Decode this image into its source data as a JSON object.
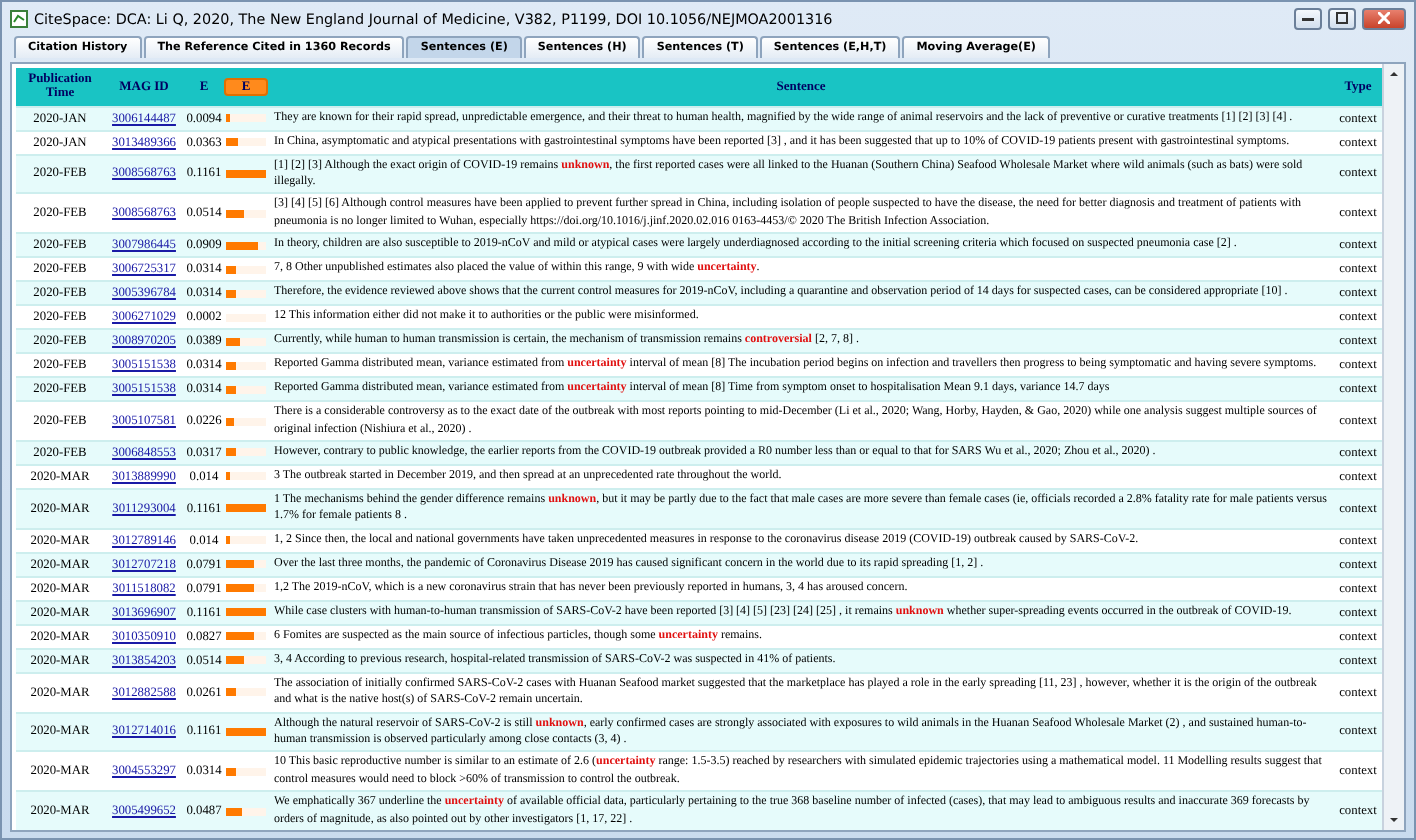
{
  "window": {
    "title": "CiteSpace: DCA: Li Q, 2020, The New England Journal of Medicine, V382, P1199, DOI 10.1056/NEJMOA2001316"
  },
  "tabs": [
    {
      "label": "Citation History",
      "selected": false
    },
    {
      "label": "The Reference Cited in 1360 Records",
      "selected": false
    },
    {
      "label": "Sentences (E)",
      "selected": true
    },
    {
      "label": "Sentences (H)",
      "selected": false
    },
    {
      "label": "Sentences (T)",
      "selected": false
    },
    {
      "label": "Sentences (E,H,T)",
      "selected": false
    },
    {
      "label": "Moving Average(E)",
      "selected": false
    }
  ],
  "table": {
    "columns": [
      {
        "label": "Publication Time",
        "kind": "text"
      },
      {
        "label": "MAG ID",
        "kind": "text"
      },
      {
        "label": "E",
        "kind": "text"
      },
      {
        "label": "E",
        "kind": "button"
      },
      {
        "label": "Sentence",
        "kind": "text"
      },
      {
        "label": "Type",
        "kind": "text"
      }
    ],
    "rows": [
      {
        "time": "2020-JAN",
        "mag_id": "3006144487",
        "e": "0.0094",
        "level": 0.081,
        "sentence": "They are known for their rapid spread, unpredictable emergence, and their threat to human health, magnified by the wide range of animal reservoirs and the lack of preventive or curative treatments [1] [2] [3] [4] .",
        "type": "context"
      },
      {
        "time": "2020-JAN",
        "mag_id": "3013489366",
        "e": "0.0363",
        "level": 0.313,
        "sentence": "In China, asymptomatic and atypical presentations with gastrointestinal symptoms have been reported [3] , and it has been suggested that up to 10% of COVID-19 patients present with gastrointestinal symptoms.",
        "type": "context"
      },
      {
        "time": "2020-FEB",
        "mag_id": "3008568763",
        "e": "0.1161",
        "level": 1,
        "sentence": "[1] [2] [3] Although the exact origin of COVID-19 remains **unknown**, the first reported cases were all linked to the Huanan (Southern China) Seafood Wholesale Market where wild animals (such as bats) were sold illegally.",
        "type": "context"
      },
      {
        "time": "2020-FEB",
        "mag_id": "3008568763",
        "e": "0.0514",
        "level": 0.443,
        "sentence": "[3] [4] [5] [6] Although control measures have been applied to prevent further spread in China, including isolation of people suspected to have the disease, the need for better diagnosis and treatment of patients with pneumonia is no longer limited to Wuhan, especially https://doi.org/10.1016/j.jinf.2020.02.016 0163-4453/© 2020 The British Infection Association.",
        "type": "context"
      },
      {
        "time": "2020-FEB",
        "mag_id": "3007986445",
        "e": "0.0909",
        "level": 0.783,
        "sentence": "In theory, children are also susceptible to 2019-nCoV and mild or atypical cases were largely underdiagnosed according to the initial screening criteria which focused on suspected pneumonia case [2] .",
        "type": "context"
      },
      {
        "time": "2020-FEB",
        "mag_id": "3006725317",
        "e": "0.0314",
        "level": 0.27,
        "sentence": "7, 8 Other unpublished estimates also placed the value of within this range, 9 with wide **uncertainty**.",
        "type": "context"
      },
      {
        "time": "2020-FEB",
        "mag_id": "3005396784",
        "e": "0.0314",
        "level": 0.27,
        "sentence": "Therefore, the evidence reviewed above shows that the current control measures for 2019-nCoV, including a quarantine and observation period of 14 days for suspected cases, can be considered appropriate [10] .",
        "type": "context"
      },
      {
        "time": "2020-FEB",
        "mag_id": "3006271029",
        "e": "0.0002",
        "level": 0.002,
        "sentence": "12 This information either did not make it to authorities or the public were misinformed.",
        "type": "context"
      },
      {
        "time": "2020-FEB",
        "mag_id": "3008970205",
        "e": "0.0389",
        "level": 0.335,
        "sentence": "Currently, while human to human transmission is certain, the mechanism of transmission remains **controversial** [2, 7, 8] .",
        "type": "context"
      },
      {
        "time": "2020-FEB",
        "mag_id": "3005151538",
        "e": "0.0314",
        "level": 0.27,
        "sentence": "Reported Gamma distributed mean, variance estimated from **uncertainty** interval of mean [8] The incubation period begins on infection and travellers then progress to being symptomatic and having severe symptoms.",
        "type": "context"
      },
      {
        "time": "2020-FEB",
        "mag_id": "3005151538",
        "e": "0.0314",
        "level": 0.27,
        "sentence": "Reported Gamma distributed mean, variance estimated from **uncertainty** interval of mean [8] Time from symptom onset to hospitalisation Mean 9.1 days, variance 14.7 days",
        "type": "context"
      },
      {
        "time": "2020-FEB",
        "mag_id": "3005107581",
        "e": "0.0226",
        "level": 0.195,
        "sentence": "There is a considerable controversy as to the exact date of the outbreak with most reports pointing to mid-December (Li et al., 2020; Wang, Horby, Hayden, & Gao, 2020) while one analysis suggest multiple sources of original infection (Nishiura et al., 2020) .",
        "type": "context"
      },
      {
        "time": "2020-FEB",
        "mag_id": "3006848553",
        "e": "0.0317",
        "level": 0.273,
        "sentence": "However, contrary to public knowledge, the earlier reports from the COVID-19 outbreak provided a R0 number less than or equal to that for SARS Wu et al., 2020; Zhou et al., 2020) .",
        "type": "context"
      },
      {
        "time": "2020-MAR",
        "mag_id": "3013889990",
        "e": "0.014",
        "level": 0.121,
        "sentence": "3 The outbreak started in December 2019, and then spread at an unprecedented rate throughout the world.",
        "type": "context"
      },
      {
        "time": "2020-MAR",
        "mag_id": "3011293004",
        "e": "0.1161",
        "level": 1,
        "sentence": "1 The mechanisms behind the gender difference remains **unknown**, but it may be partly due to the fact that male cases are more severe than female cases (ie, officials recorded a 2.8% fatality rate for male patients versus 1.7% for female patients 8 .",
        "type": "context"
      },
      {
        "time": "2020-MAR",
        "mag_id": "3012789146",
        "e": "0.014",
        "level": 0.121,
        "sentence": "1, 2 Since then, the local and national governments have taken unprecedented measures in response to the coronavirus disease 2019 (COVID-19) outbreak caused by SARS-CoV-2.",
        "type": "context"
      },
      {
        "time": "2020-MAR",
        "mag_id": "3012707218",
        "e": "0.0791",
        "level": 0.681,
        "sentence": "Over the last three months, the pandemic of Coronavirus Disease 2019 has caused significant concern in the world due to its rapid spreading [1, 2] .",
        "type": "context"
      },
      {
        "time": "2020-MAR",
        "mag_id": "3011518082",
        "e": "0.0791",
        "level": 0.681,
        "sentence": "1,2 The 2019-nCoV, which is a new coronavirus strain that has never been previously reported in humans, 3, 4 has aroused concern.",
        "type": "context"
      },
      {
        "time": "2020-MAR",
        "mag_id": "3013696907",
        "e": "0.1161",
        "level": 1,
        "sentence": "While case clusters with human-to-human transmission of SARS-CoV-2 have been reported [3] [4] [5] [23] [24] [25] , it remains **unknown** whether super-spreading events occurred in the outbreak of COVID-19.",
        "type": "context"
      },
      {
        "time": "2020-MAR",
        "mag_id": "3010350910",
        "e": "0.0827",
        "level": 0.712,
        "sentence": "6 Fomites are suspected as the main source of infectious particles, though some **uncertainty** remains.",
        "type": "context"
      },
      {
        "time": "2020-MAR",
        "mag_id": "3013854203",
        "e": "0.0514",
        "level": 0.443,
        "sentence": "3, 4 According to previous research, hospital-related transmission of SARS-CoV-2 was suspected in 41% of patients.",
        "type": "context"
      },
      {
        "time": "2020-MAR",
        "mag_id": "3012882588",
        "e": "0.0261",
        "level": 0.225,
        "sentence": "The association of initially confirmed SARS-CoV-2 cases with Huanan Seafood market suggested that the marketplace has played a role in the early spreading [11, 23] , however, whether it is the origin of the outbreak and what is the native host(s) of SARS-CoV-2 remain uncertain.",
        "type": "context"
      },
      {
        "time": "2020-MAR",
        "mag_id": "3012714016",
        "e": "0.1161",
        "level": 1,
        "sentence": "Although the natural reservoir of SARS-CoV-2 is still **unknown**, early confirmed cases are strongly associated with exposures to wild animals in the Huanan Seafood Wholesale Market (2) , and sustained human-to-human transmission is observed particularly among close contacts (3, 4) .",
        "type": "context"
      },
      {
        "time": "2020-MAR",
        "mag_id": "3004553297",
        "e": "0.0314",
        "level": 0.27,
        "sentence": "10 This basic reproductive number is similar to an estimate of 2.6 (**uncertainty** range: 1.5-3.5) reached by researchers with simulated epidemic trajectories using a mathematical model. 11 Modelling results suggest that control measures would need to block >60% of transmission to control the outbreak.",
        "type": "context"
      },
      {
        "time": "2020-MAR",
        "mag_id": "3005499652",
        "e": "0.0487",
        "level": 0.419,
        "sentence": "We emphatically 367 underline the **uncertainty** of available official data, particularly pertaining to the true 368 baseline number of infected (cases), that may lead to ambiguous results and inaccurate 369 forecasts by orders of magnitude, as also pointed out by other investigators [1, 17, 22] .",
        "type": "context"
      }
    ]
  }
}
